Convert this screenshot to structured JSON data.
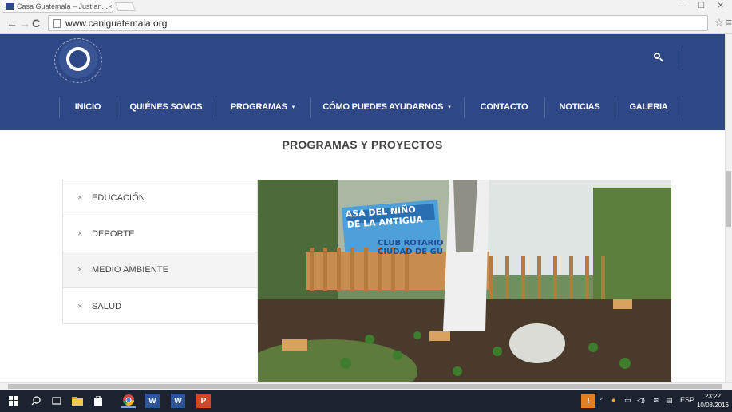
{
  "browser": {
    "tab_title": "Casa Guatemala – Just an...",
    "tab_close": "×",
    "url": "www.caniguatemala.org"
  },
  "site": {
    "search_icon": "search-icon",
    "nav": [
      {
        "label": "INICIO",
        "has_caret": false
      },
      {
        "label": "QUIÉNES SOMOS",
        "has_caret": false
      },
      {
        "label": "PROGRAMAS",
        "has_caret": true
      },
      {
        "label": "CÓMO PUEDES AYUDARNOS",
        "has_caret": true
      },
      {
        "label": "CONTACTO",
        "has_caret": false
      },
      {
        "label": "NOTICIAS",
        "has_caret": false
      },
      {
        "label": "GALERIA",
        "has_caret": false
      }
    ],
    "caret": "▾",
    "page_title": "PROGRAMAS Y PROYECTOS",
    "programs": [
      {
        "label": "EDUCACIÓN",
        "active": false
      },
      {
        "label": "DEPORTE",
        "active": false
      },
      {
        "label": "MEDIO AMBIENTE",
        "active": true
      },
      {
        "label": "SALUD",
        "active": false
      }
    ],
    "program_bullet": "×",
    "photo_banner_line1": "ASA DEL NIÑO",
    "photo_banner_line2": "DE LA ANTIGUA",
    "photo_banner_line3": "CLUB ROTARIO",
    "photo_banner_line4": "CIUDAD DE GU",
    "colors": {
      "header_bg": "#2e4787",
      "nav_text": "#ffffff"
    }
  },
  "taskbar": {
    "language": "ESP",
    "time": "23:22",
    "date": "10/08/2016"
  }
}
